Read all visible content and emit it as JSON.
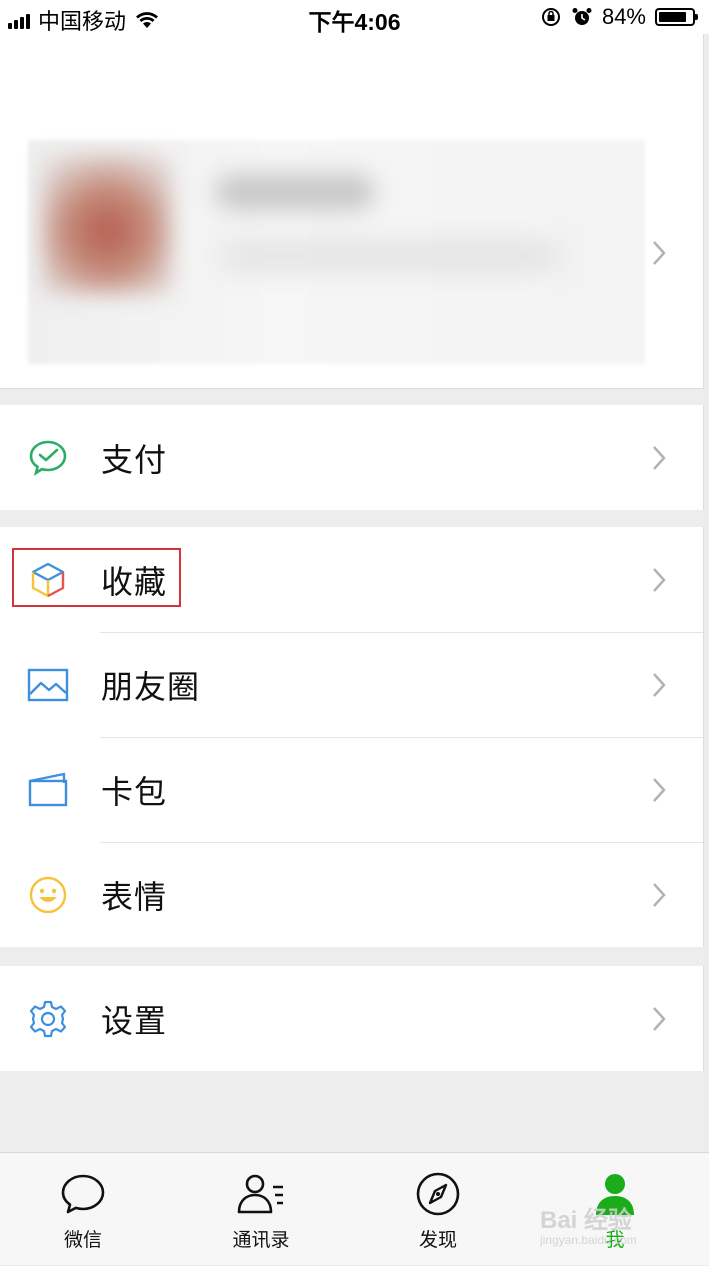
{
  "status_bar": {
    "carrier": "中国移动",
    "time": "下午4:06",
    "battery_percent": "84%",
    "battery_level": 0.84
  },
  "profile": {
    "blurred": true
  },
  "menu": {
    "group1": [
      {
        "label": "支付",
        "icon": "wechat-pay-icon",
        "color": "#2aae67"
      }
    ],
    "group2": [
      {
        "label": "收藏",
        "icon": "favorites-cube-icon",
        "color": "#e8534c",
        "highlighted": true
      },
      {
        "label": "朋友圈",
        "icon": "moments-picture-icon",
        "color": "#3d8fe0"
      },
      {
        "label": "卡包",
        "icon": "card-wallet-icon",
        "color": "#3d8fe0"
      },
      {
        "label": "表情",
        "icon": "sticker-smiley-icon",
        "color": "#f5c23a"
      }
    ],
    "group3": [
      {
        "label": "设置",
        "icon": "settings-gear-icon",
        "color": "#3d8fe0"
      }
    ]
  },
  "tabbar": {
    "tabs": [
      {
        "label": "微信",
        "icon": "chat-bubble-icon",
        "active": false
      },
      {
        "label": "通讯录",
        "icon": "contacts-icon",
        "active": false
      },
      {
        "label": "发现",
        "icon": "compass-icon",
        "active": false
      },
      {
        "label": "我",
        "icon": "me-person-icon",
        "active": true
      }
    ],
    "active_color": "#1aad19"
  },
  "watermark": {
    "text": "Bai 经验",
    "sub": "jingyan.baidu.com"
  }
}
